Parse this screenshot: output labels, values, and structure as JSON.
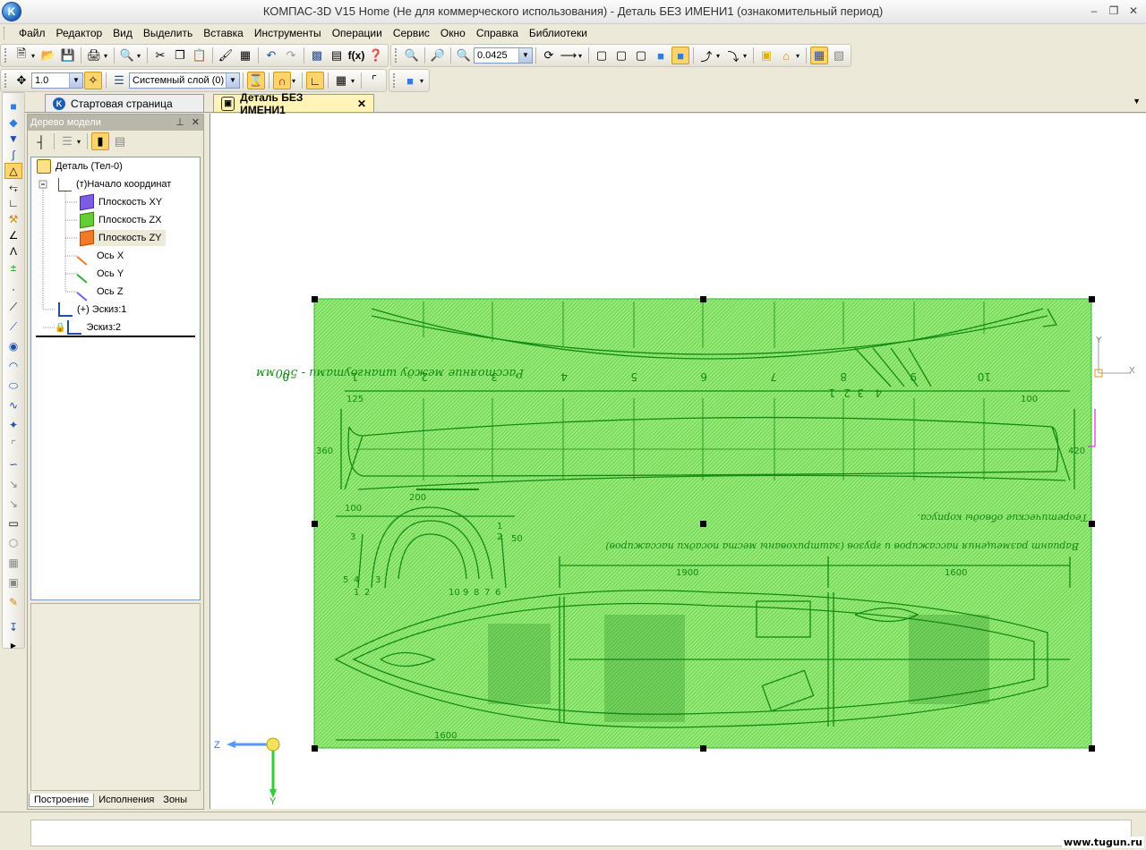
{
  "window": {
    "title": "КОМПАС-3D V15 Home (Не для коммерческого использования) - Деталь БЕЗ ИМЕНИ1 (ознакомительный период)"
  },
  "menu": [
    {
      "label": "Файл"
    },
    {
      "label": "Редактор"
    },
    {
      "label": "Вид"
    },
    {
      "label": "Выделить"
    },
    {
      "label": "Вставка"
    },
    {
      "label": "Инструменты"
    },
    {
      "label": "Операции"
    },
    {
      "label": "Сервис"
    },
    {
      "label": "Окно"
    },
    {
      "label": "Справка"
    },
    {
      "label": "Библиотеки"
    }
  ],
  "toolbar": {
    "zoom_value": "0.0425",
    "step_value": "1.0",
    "layer_value": "Системный слой (0)"
  },
  "tabs": [
    {
      "label": "Стартовая страница"
    },
    {
      "label": "Деталь БЕЗ ИМЕНИ1",
      "close": "✕"
    }
  ],
  "tree_panel": {
    "title": "Дерево модели",
    "items": [
      {
        "label": "Деталь (Тел-0)"
      },
      {
        "label": "(т)Начало координат"
      },
      {
        "label": "Плоскость XY"
      },
      {
        "label": "Плоскость ZX"
      },
      {
        "label": "Плоскость ZY"
      },
      {
        "label": "Ось X"
      },
      {
        "label": "Ось Y"
      },
      {
        "label": "Ось Z"
      },
      {
        "label": "(+) Эскиз:1"
      },
      {
        "label": "Эскиз:2"
      }
    ],
    "bottom_tabs": [
      {
        "label": "Построение"
      },
      {
        "label": "Исполнения"
      },
      {
        "label": "Зоны"
      }
    ]
  },
  "canvas": {
    "axis_labels": {
      "y_top": "Y",
      "x_right": "X",
      "z_left": "Z",
      "y_bottom": "Y"
    },
    "drawing_texts": {
      "caption_top": "Расстояние между шпангоутами - 500мм",
      "caption_mid": "Теоретические обводы корпуса.",
      "caption_plan": "Вариант размещения пассажиров и грузов (заштрихованы места посадки пассажиров)",
      "station_labels": [
        "0",
        "1",
        "2",
        "3",
        "4",
        "5",
        "6",
        "7",
        "8",
        "9",
        "10"
      ],
      "top_numbers": [
        "4",
        "3",
        "2",
        "1"
      ],
      "dims": {
        "d1": "125",
        "d2": "100",
        "d3": "360",
        "d4": "420",
        "d5": "200",
        "d6": "100",
        "d7": "1900",
        "d8": "1600",
        "d9": "1600",
        "d10": "50"
      },
      "section_left_nums": [
        "1",
        "2",
        "3",
        "4",
        "5"
      ],
      "section_right_nums": [
        "10",
        "9",
        "8",
        "7",
        "6"
      ],
      "section_side_nums": [
        "3",
        "2",
        "1"
      ]
    }
  },
  "footer": {
    "watermark": "www.tugun.ru"
  },
  "colors": {
    "selection_fill": "#66dd44",
    "drawing_ink": "#138a13",
    "handle": "#000000",
    "axis_blue": "#5599ff",
    "axis_green": "#33cc33",
    "axis_magenta": "#cc33cc"
  }
}
